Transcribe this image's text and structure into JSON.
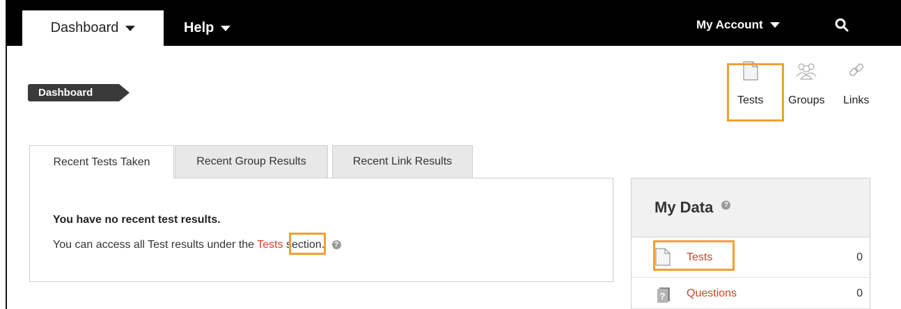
{
  "topnav": {
    "dashboard_label": "Dashboard",
    "help_label": "Help",
    "account_label": "My Account"
  },
  "breadcrumb": {
    "current": "Dashboard"
  },
  "shortcuts": [
    {
      "label": "Tests",
      "icon": "document-icon"
    },
    {
      "label": "Groups",
      "icon": "groups-icon"
    },
    {
      "label": "Links",
      "icon": "link-icon"
    }
  ],
  "tabs": [
    {
      "label": "Recent Tests Taken",
      "active": true
    },
    {
      "label": "Recent Group Results",
      "active": false
    },
    {
      "label": "Recent Link Results",
      "active": false
    }
  ],
  "panel": {
    "title": "You have no recent test results.",
    "text_before": "You can access all Test results under the ",
    "link": "Tests",
    "text_after": " section."
  },
  "mydata": {
    "title": "My Data",
    "rows": [
      {
        "label": "Tests",
        "count": "0",
        "icon": "document-icon"
      },
      {
        "label": "Questions",
        "count": "0",
        "icon": "question-icon"
      }
    ]
  },
  "colors": {
    "accent": "#c8462a",
    "highlight": "#f0a033",
    "topbar": "#000000"
  }
}
